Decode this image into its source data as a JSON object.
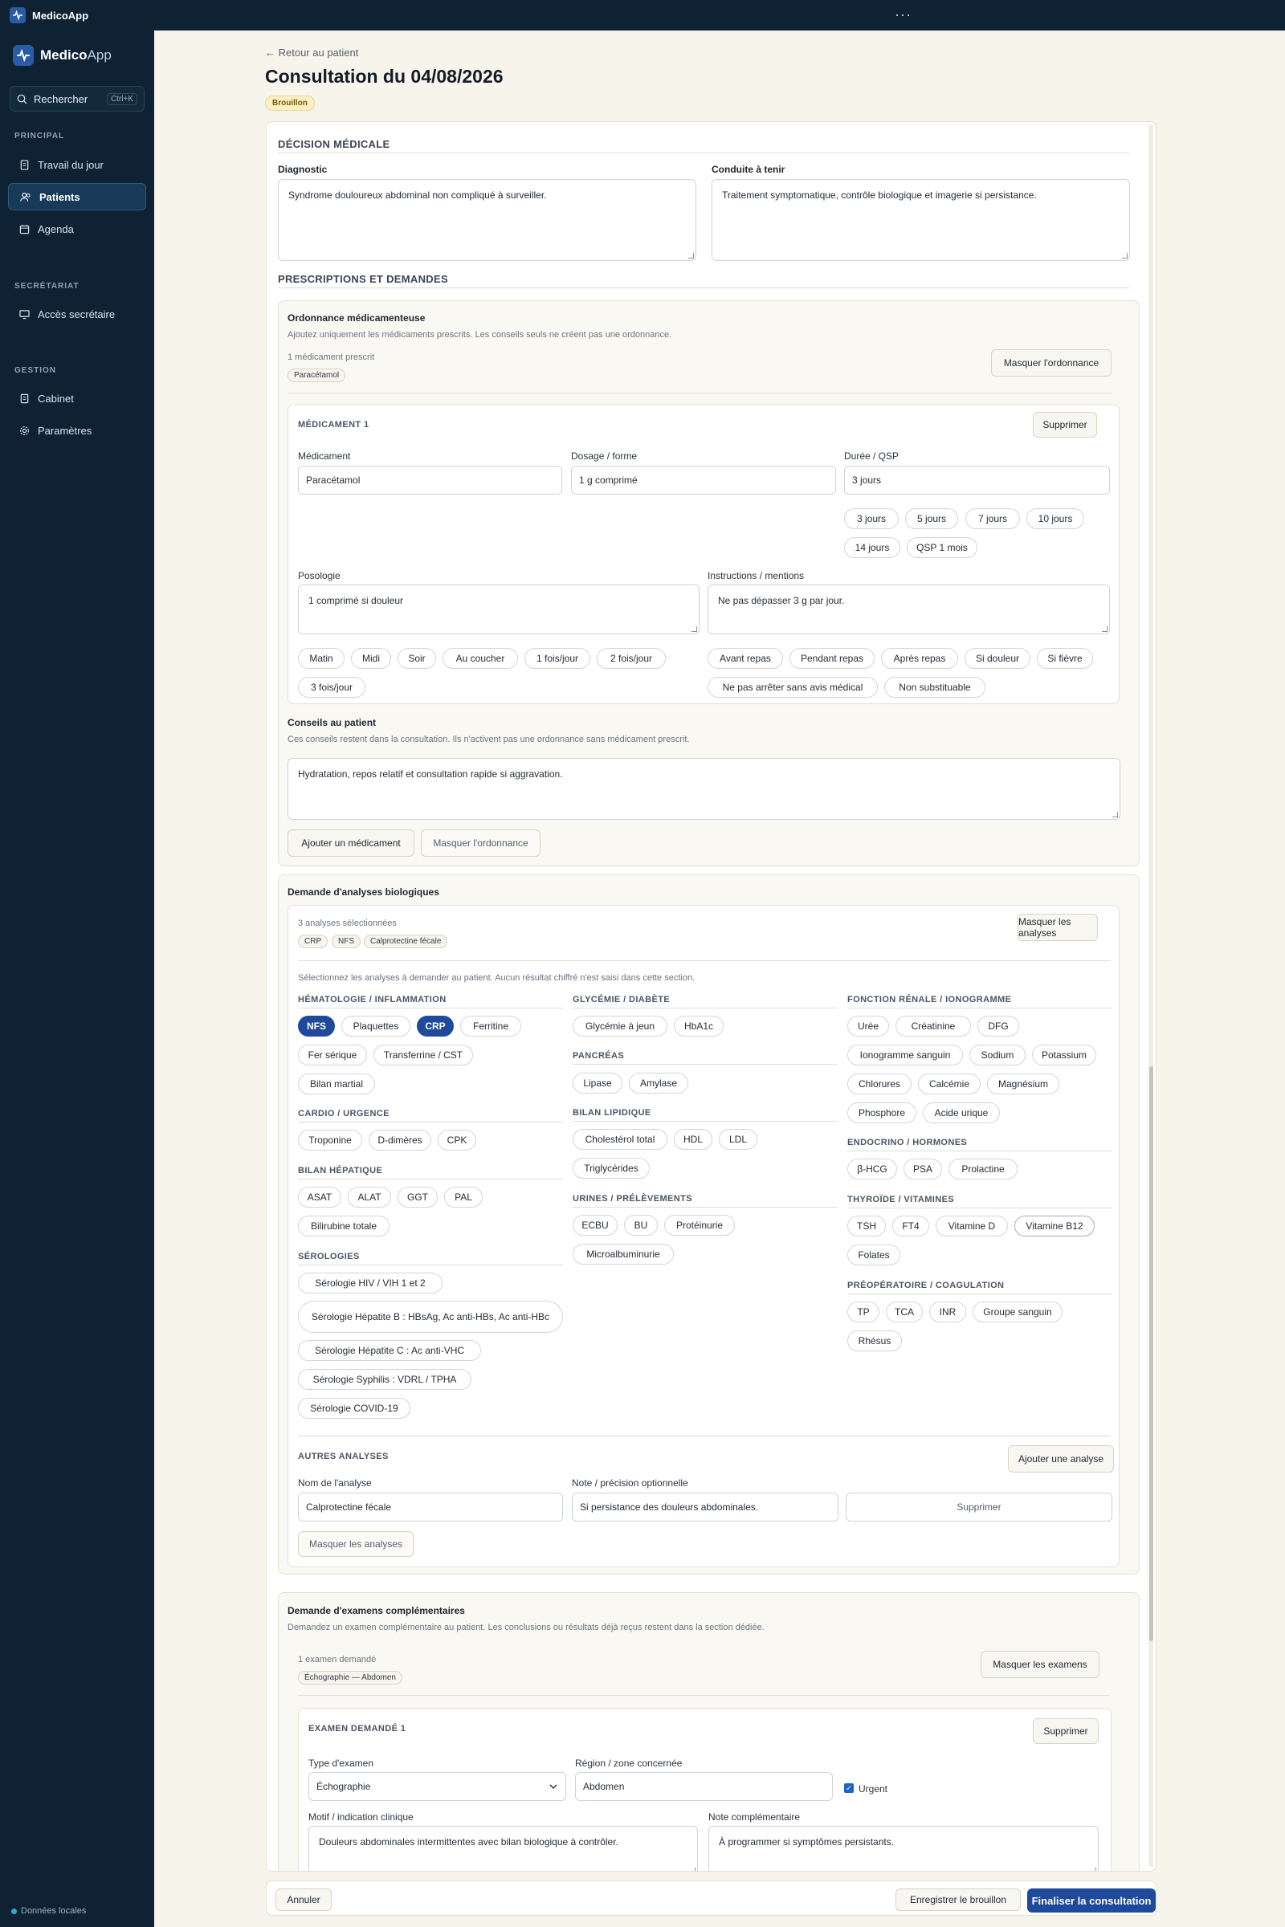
{
  "app": {
    "title": "MedicoApp",
    "dots": "···",
    "brand_a": "Medico",
    "brand_b": "App"
  },
  "sidebar": {
    "search_label": "Rechercher",
    "search_kbd": "Ctrl+K",
    "sec_principal": "PRINCIPAL",
    "sec_secretariat": "SECRÉTARIAT",
    "sec_gestion": "GESTION",
    "items": {
      "travail": "Travail du jour",
      "patients": "Patients",
      "agenda": "Agenda",
      "secretaire": "Accès secrétaire",
      "cabinet": "Cabinet",
      "parametres": "Paramètres"
    },
    "footer": "Données locales"
  },
  "page": {
    "back": "← Retour au patient",
    "title": "Consultation du 04/08/2026",
    "status": "Brouillon"
  },
  "decision": {
    "heading": "DÉCISION MÉDICALE",
    "diag_label": "Diagnostic",
    "diag_value": "Syndrome douloureux abdominal non compliqué à surveiller.",
    "cat_label": "Conduite à tenir",
    "cat_value": "Traitement symptomatique, contrôle biologique et imagerie si persistance."
  },
  "prescriptions": {
    "heading": "PRESCRIPTIONS ET DEMANDES",
    "ordo_title": "Ordonnance médicamenteuse",
    "ordo_desc": "Ajoutez uniquement les médicaments prescrits. Les conseils seuls ne créent pas une ordonnance.",
    "ordo_count": "1 médicament prescrit",
    "ordo_tag": "Paracétamol",
    "ordo_hide": "Masquer l'ordonnance",
    "med": {
      "heading": "MÉDICAMENT 1",
      "delete": "Supprimer",
      "name_label": "Médicament",
      "name_value": "Paracétamol",
      "dose_label": "Dosage / forme",
      "dose_value": "1 g comprimé",
      "dur_label": "Durée / QSP",
      "dur_value": "3 jours",
      "dur_chips": [
        "3 jours",
        "5 jours",
        "7 jours",
        "10 jours",
        "14 jours",
        "QSP 1 mois"
      ],
      "poso_label": "Posologie",
      "poso_value": "1 comprimé si douleur",
      "instr_label": "Instructions / mentions",
      "instr_value": "Ne pas dépasser 3 g par jour.",
      "poso_chips": [
        "Matin",
        "Midi",
        "Soir",
        "Au coucher",
        "1 fois/jour",
        "2 fois/jour",
        "3 fois/jour"
      ],
      "instr_chips": [
        "Avant repas",
        "Pendant repas",
        "Après repas",
        "Si douleur",
        "Si fièvre",
        "Ne pas arrêter sans avis médical",
        "Non substituable"
      ]
    },
    "advice_label": "Conseils au patient",
    "advice_desc": "Ces conseils restent dans la consultation. Ils n'activent pas une ordonnance sans médicament prescrit.",
    "advice_value": "Hydratation, repos relatif et consultation rapide si aggravation.",
    "add_med": "Ajouter un médicament",
    "hide_ordo": "Masquer l'ordonnance"
  },
  "bio": {
    "title": "Demande d'analyses biologiques",
    "count": "3 analyses sélectionnées",
    "tags": [
      "CRP",
      "NFS",
      "Calprotectine fécale"
    ],
    "hide": "Masquer les analyses",
    "desc": "Sélectionnez les analyses à demander au patient. Aucun résultat chiffré n'est saisi dans cette section.",
    "cats": {
      "hemato": "HÉMATOLOGIE / INFLAMMATION",
      "cardio": "CARDIO / URGENCE",
      "hepat": "BILAN HÉPATIQUE",
      "sero": "SÉROLOGIES",
      "glyc": "GLYCÉMIE / DIABÈTE",
      "panc": "PANCRÉAS",
      "lipid": "BILAN LIPIDIQUE",
      "urine": "URINES / PRÉLÈVEMENTS",
      "renal": "FONCTION RÉNALE / IONOGRAMME",
      "endo": "ENDOCRINO / HORMONES",
      "thyro": "THYROÏDE / VITAMINES",
      "preop": "PRÉOPÉRATOIRE / COAGULATION"
    },
    "chips": {
      "nfs": "NFS",
      "plaquettes": "Plaquettes",
      "crp": "CRP",
      "ferritine": "Ferritine",
      "fer": "Fer sérique",
      "transf": "Transferrine / CST",
      "bilanmartial": "Bilan martial",
      "troponine": "Troponine",
      "ddim": "D-dimères",
      "cpk": "CPK",
      "asat": "ASAT",
      "alat": "ALAT",
      "ggt": "GGT",
      "pal": "PAL",
      "bili": "Bilirubine totale",
      "hiv": "Sérologie HIV / VIH 1 et 2",
      "hepb": "Sérologie Hépatite B : HBsAg, Ac anti-HBs, Ac anti-HBc",
      "hepc": "Sérologie Hépatite C : Ac anti-VHC",
      "syph": "Sérologie Syphilis : VDRL / TPHA",
      "covid": "Sérologie COVID-19",
      "glyjeun": "Glycémie à jeun",
      "hba1c": "HbA1c",
      "lipase": "Lipase",
      "amylase": "Amylase",
      "choltot": "Cholestérol total",
      "hdl": "HDL",
      "ldl": "LDL",
      "trig": "Triglycérides",
      "ecbu": "ECBU",
      "bu": "BU",
      "proteinurie": "Protéinurie",
      "microalb": "Microalbuminurie",
      "uree": "Urée",
      "creat": "Créatinine",
      "dfg": "DFG",
      "iono": "Ionogramme sanguin",
      "sodium": "Sodium",
      "potassium": "Potassium",
      "chlorures": "Chlorures",
      "calcemie": "Calcémie",
      "magnesium": "Magnésium",
      "phosphore": "Phosphore",
      "acideurique": "Acide urique",
      "bhcg": "β-HCG",
      "psa": "PSA",
      "prolactine": "Prolactine",
      "tsh": "TSH",
      "ft4": "FT4",
      "vitd": "Vitamine D",
      "vitb12": "Vitamine B12",
      "folates": "Folates",
      "tp": "TP",
      "tca": "TCA",
      "inr": "INR",
      "groupe": "Groupe sanguin",
      "rhesus": "Rhésus"
    },
    "other_heading": "AUTRES ANALYSES",
    "add": "Ajouter une analyse",
    "other_name_label": "Nom de l'analyse",
    "other_name_value": "Calprotectine fécale",
    "other_note_label": "Note / précision optionnelle",
    "other_note_value": "Si persistance des douleurs abdominales.",
    "other_delete": "Supprimer",
    "hide_bottom": "Masquer les analyses"
  },
  "exams": {
    "title": "Demande d'examens complémentaires",
    "desc": "Demandez un examen complémentaire au patient. Les conclusions ou résultats déjà reçus restent dans la section dédiée.",
    "count": "1 examen demandé",
    "tag": "Échographie — Abdomen",
    "hide": "Masquer les examens",
    "item": {
      "heading": "EXAMEN DEMANDÉ 1",
      "delete": "Supprimer",
      "type_label": "Type d'examen",
      "type_value": "Échographie",
      "region_label": "Région / zone concernée",
      "region_value": "Abdomen",
      "urgent": "Urgent",
      "motif_label": "Motif / indication clinique",
      "motif_value": "Douleurs abdominales intermittentes avec bilan biologique à contrôler.",
      "note_label": "Note complémentaire",
      "note_value": "À programmer si symptômes persistants."
    }
  },
  "footer": {
    "cancel": "Annuler",
    "save": "Enregistrer le brouillon",
    "finalize": "Finaliser la consultation"
  }
}
